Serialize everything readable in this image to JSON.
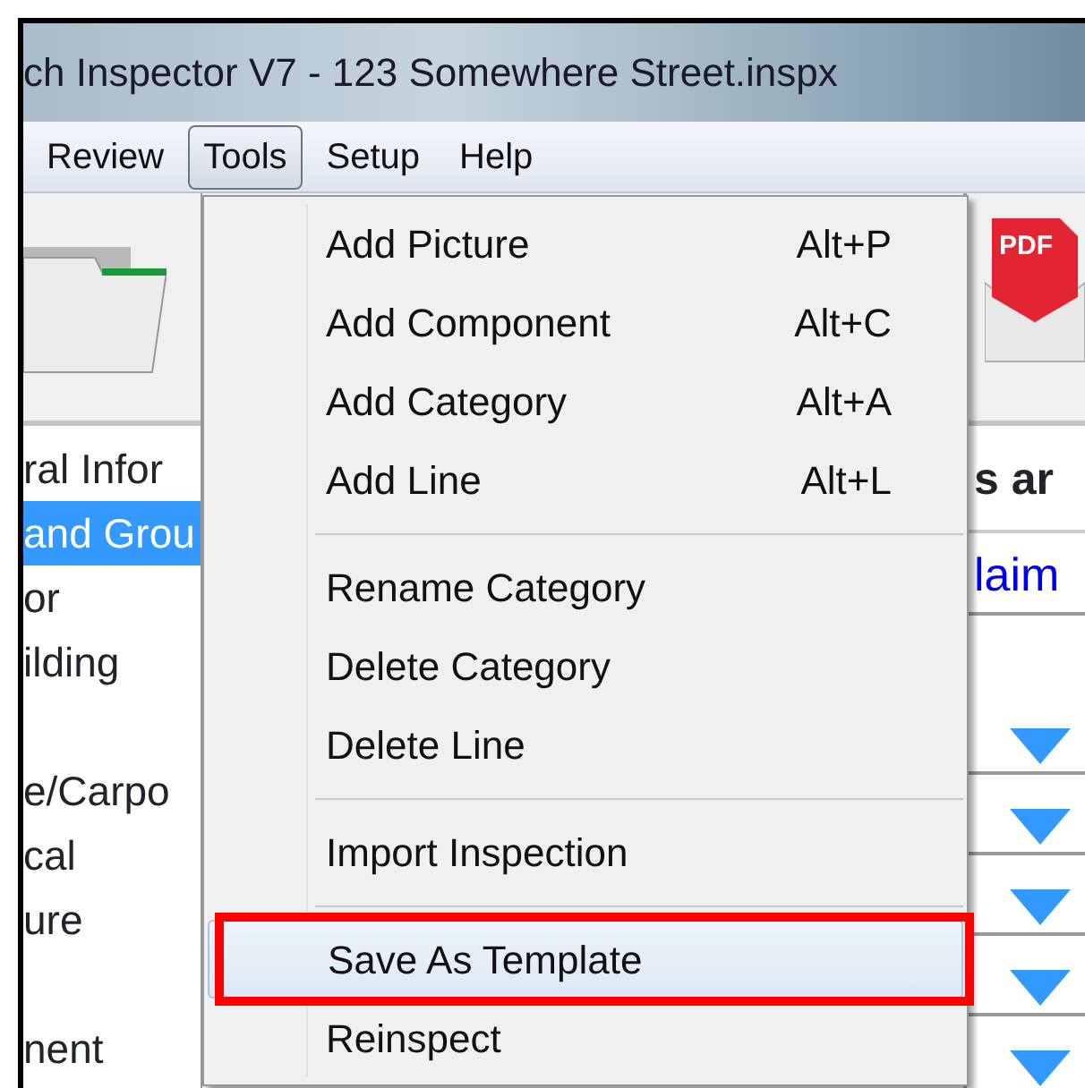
{
  "window": {
    "title": "ch Inspector V7 - 123 Somewhere Street.inspx"
  },
  "menubar": [
    {
      "label": "Review",
      "selected": false
    },
    {
      "label": "Tools",
      "selected": true
    },
    {
      "label": "Setup",
      "selected": false
    },
    {
      "label": "Help",
      "selected": false
    }
  ],
  "toolbar": {
    "pdf_label": "PDF"
  },
  "tree": [
    {
      "kind": "node",
      "label": "ral Infor",
      "selected": false
    },
    {
      "kind": "node",
      "label": "and Grou",
      "selected": true
    },
    {
      "kind": "node",
      "label": "or",
      "selected": false
    },
    {
      "kind": "node",
      "label": "ilding",
      "selected": false
    },
    {
      "kind": "spacer"
    },
    {
      "kind": "node",
      "label": "e/Carpo",
      "selected": false
    },
    {
      "kind": "node",
      "label": "cal",
      "selected": false
    },
    {
      "kind": "node",
      "label": "ure",
      "selected": false
    },
    {
      "kind": "spacer"
    },
    {
      "kind": "node",
      "label": "nent",
      "selected": false
    }
  ],
  "content": {
    "heading": "s ar",
    "link": "laim",
    "rows": [
      {
        "kind": "dropdown"
      },
      {
        "kind": "dropdown"
      },
      {
        "kind": "dropdown"
      },
      {
        "kind": "dropdown"
      },
      {
        "kind": "dropdown"
      }
    ]
  },
  "tools_menu": [
    {
      "kind": "item",
      "label": "Add Picture",
      "shortcut": "Alt+P",
      "selected": false,
      "outlined": false
    },
    {
      "kind": "item",
      "label": "Add Component",
      "shortcut": "Alt+C",
      "selected": false,
      "outlined": false
    },
    {
      "kind": "item",
      "label": "Add Category",
      "shortcut": "Alt+A",
      "selected": false,
      "outlined": false
    },
    {
      "kind": "item",
      "label": "Add Line",
      "shortcut": "Alt+L",
      "selected": false,
      "outlined": false
    },
    {
      "kind": "separator"
    },
    {
      "kind": "item",
      "label": "Rename Category",
      "selected": false,
      "outlined": false
    },
    {
      "kind": "item",
      "label": "Delete Category",
      "selected": false,
      "outlined": false
    },
    {
      "kind": "item",
      "label": "Delete Line",
      "selected": false,
      "outlined": false
    },
    {
      "kind": "separator"
    },
    {
      "kind": "item",
      "label": "Import Inspection",
      "selected": false,
      "outlined": false
    },
    {
      "kind": "separator"
    },
    {
      "kind": "item",
      "label": "Save As Template",
      "selected": true,
      "outlined": true
    },
    {
      "kind": "item",
      "label": "Reinspect",
      "selected": false,
      "outlined": false
    }
  ]
}
